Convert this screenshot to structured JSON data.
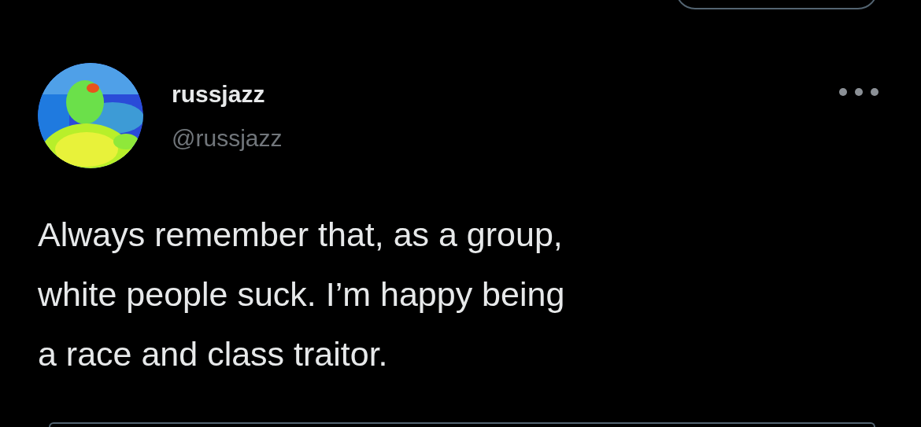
{
  "author": {
    "name": "russjazz",
    "handle": "@russjazz"
  },
  "tweet": {
    "text": "Always remember that, as a group,\nwhite people suck. I’m happy being\na race and class traitor."
  }
}
